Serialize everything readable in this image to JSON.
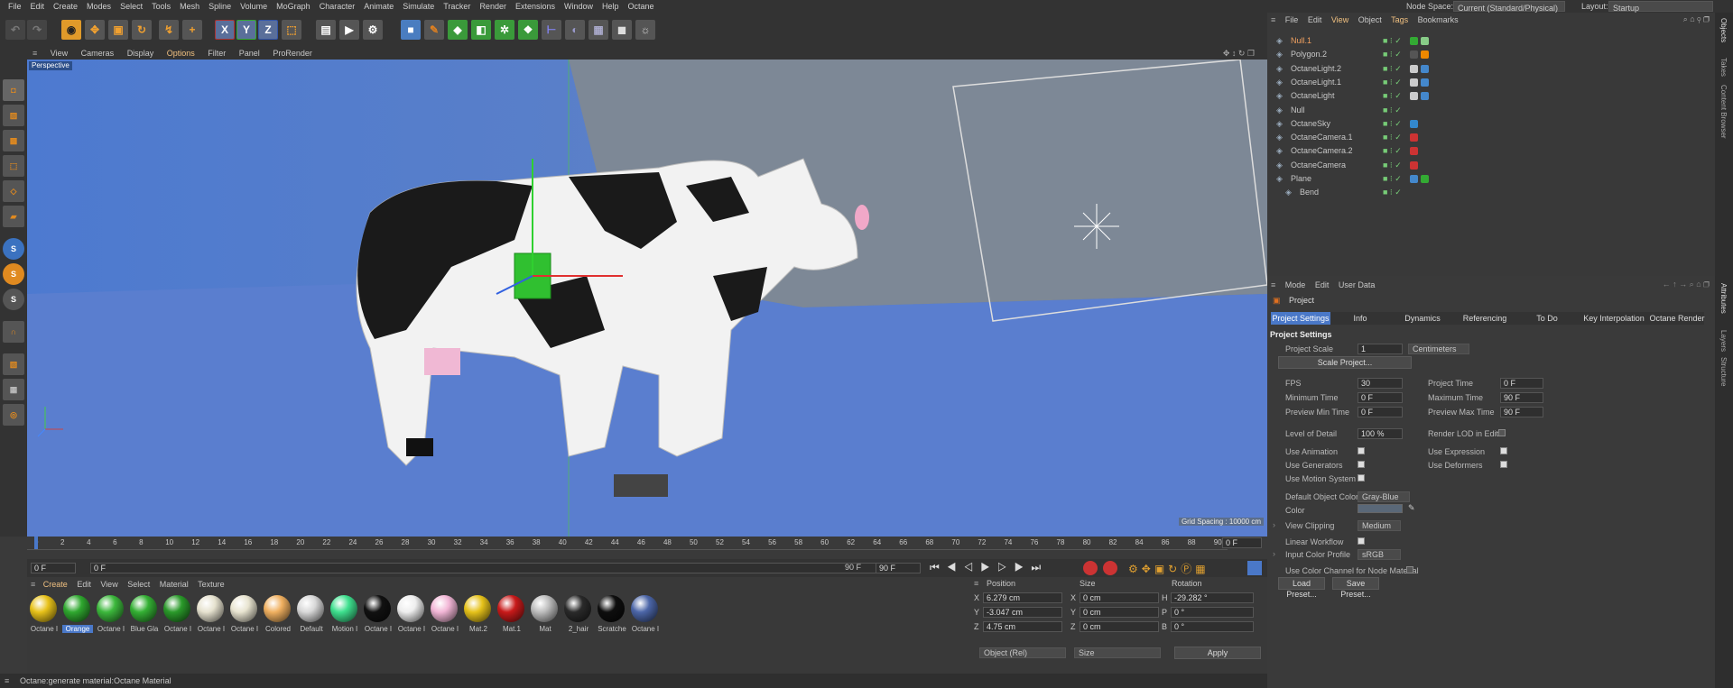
{
  "menubar": {
    "items": [
      "File",
      "Edit",
      "Create",
      "Modes",
      "Select",
      "Tools",
      "Mesh",
      "Spline",
      "Volume",
      "MoGraph",
      "Character",
      "Animate",
      "Simulate",
      "Tracker",
      "Render",
      "Extensions",
      "Window",
      "Help",
      "Octane"
    ],
    "node_space_label": "Node Space:",
    "node_space_value": "Current (Standard/Physical)",
    "layout_label": "Layout:",
    "layout_value": "Startup"
  },
  "viewport": {
    "menu": [
      "View",
      "Cameras",
      "Display",
      "Options",
      "Filter",
      "Panel",
      "ProRender"
    ],
    "label": "Perspective",
    "grid_spacing": "Grid Spacing : 10000 cm"
  },
  "timeline": {
    "ticks": [
      "0",
      "2",
      "4",
      "6",
      "8",
      "10",
      "12",
      "14",
      "16",
      "18",
      "20",
      "22",
      "24",
      "26",
      "28",
      "30",
      "32",
      "34",
      "36",
      "38",
      "40",
      "42",
      "44",
      "46",
      "48",
      "50",
      "52",
      "54",
      "56",
      "58",
      "60",
      "62",
      "64",
      "66",
      "68",
      "70",
      "72",
      "74",
      "76",
      "78",
      "80",
      "82",
      "84",
      "86",
      "88",
      "90"
    ],
    "current_frame": "0 F"
  },
  "transport": {
    "start": "0 F",
    "start2": "0 F",
    "end": "90 F",
    "end2": "90 F"
  },
  "materials": {
    "menu": [
      "Create",
      "Edit",
      "View",
      "Select",
      "Material",
      "Texture"
    ],
    "items": [
      {
        "label": "Octane I",
        "color": "#e8c21a"
      },
      {
        "label": "Orange",
        "color": "#2fa82f"
      },
      {
        "label": "Octane I",
        "color": "#3cb83c"
      },
      {
        "label": "Blue Gla",
        "color": "#34b034"
      },
      {
        "label": "Octane I",
        "color": "#2a9a2a"
      },
      {
        "label": "Octane I",
        "color": "#e6e2cf"
      },
      {
        "label": "Octane I",
        "color": "#e8e4d0"
      },
      {
        "label": "Colored",
        "color": "#f0b060"
      },
      {
        "label": "Default",
        "color": "#d8d8d8"
      },
      {
        "label": "Motion I",
        "color": "#3ee08e"
      },
      {
        "label": "Octane I",
        "color": "#111111"
      },
      {
        "label": "Octane I",
        "color": "#eeeeee"
      },
      {
        "label": "Octane I",
        "color": "#f2b6d6"
      },
      {
        "label": "Mat.2",
        "color": "#e6c21a"
      },
      {
        "label": "Mat.1",
        "color": "#c81a1a"
      },
      {
        "label": "Mat",
        "color": "#bdbdbd"
      },
      {
        "label": "2_hair",
        "color": "#2a2a2a"
      },
      {
        "label": "Scratche",
        "color": "#0e0e0e"
      },
      {
        "label": "Octane I",
        "color": "#4c66a8"
      }
    ]
  },
  "coords": {
    "headers": [
      "Position",
      "Size",
      "Rotation"
    ],
    "rows": [
      {
        "axis": "X",
        "pos": "6.279 cm",
        "saxis": "X",
        "size": "0 cm",
        "raxis": "H",
        "rot": "-29.282 °"
      },
      {
        "axis": "Y",
        "pos": "-3.047 cm",
        "saxis": "Y",
        "size": "0 cm",
        "raxis": "P",
        "rot": "0 °"
      },
      {
        "axis": "Z",
        "pos": "4.75 cm",
        "saxis": "Z",
        "size": "0 cm",
        "raxis": "B",
        "rot": "0 °"
      }
    ],
    "mode": "Object (Rel)",
    "size_mode": "Size",
    "apply": "Apply"
  },
  "status": "Octane:generate material:Octane Material",
  "objects": {
    "menu": [
      "File",
      "Edit",
      "View",
      "Object",
      "Tags",
      "Bookmarks"
    ],
    "list": [
      "Null.1",
      "Polygon.2",
      "OctaneLight.2",
      "OctaneLight.1",
      "OctaneLight",
      "Null",
      "OctaneSky",
      "OctaneCamera.1",
      "OctaneCamera.2",
      "OctaneCamera",
      "Plane",
      "Bend"
    ]
  },
  "rightstrip": {
    "top": [
      "Objects",
      "Takes",
      "Content Browser"
    ],
    "bottom": [
      "Attributes",
      "Layers",
      "Structure"
    ]
  },
  "attributes": {
    "menu": [
      "Mode",
      "Edit",
      "User Data"
    ],
    "title": "Project",
    "tabs": [
      "Project Settings",
      "Info",
      "Dynamics",
      "Referencing",
      "To Do",
      "Key Interpolation",
      "Octane Render"
    ],
    "section": "Project Settings",
    "project_scale_label": "Project Scale",
    "project_scale_value": "1",
    "project_scale_unit": "Centimeters",
    "scale_button": "Scale Project...",
    "fps_label": "FPS",
    "fps": "30",
    "project_time_label": "Project Time",
    "project_time": "0 F",
    "min_time_label": "Minimum Time",
    "min_time": "0 F",
    "max_time_label": "Maximum Time",
    "max_time": "90 F",
    "prev_min_label": "Preview Min Time",
    "prev_min": "0 F",
    "prev_max_label": "Preview Max Time",
    "prev_max": "90 F",
    "lod_label": "Level of Detail",
    "lod": "100 %",
    "render_lod_label": "Render LOD in Editor",
    "use_animation": "Use Animation",
    "use_expression": "Use Expression",
    "use_generators": "Use Generators",
    "use_deformers": "Use Deformers",
    "use_motion": "Use Motion System",
    "default_color_label": "Default Object Color",
    "default_color": "Gray-Blue",
    "color_label": "Color",
    "view_clipping_label": "View Clipping",
    "view_clipping": "Medium",
    "linear_workflow": "Linear Workflow",
    "input_profile_label": "Input Color Profile",
    "input_profile": "sRGB",
    "color_channel": "Use Color Channel for Node Material",
    "load_preset": "Load Preset...",
    "save_preset": "Save Preset..."
  }
}
